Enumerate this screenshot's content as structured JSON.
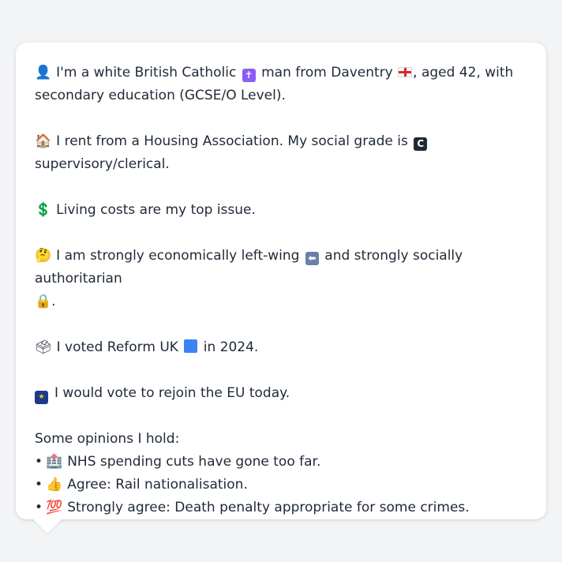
{
  "profile": {
    "intro": {
      "icon": "👤",
      "part1": "I'm a white British Catholic",
      "religion_icon": "✝",
      "part2": "man from Daventry",
      "part3": ", aged 42, with",
      "part4": "secondary education (GCSE/O Level)."
    },
    "housing": {
      "icon": "🏠",
      "part1": "I rent from a Housing Association. My social grade is",
      "grade_icon": "C",
      "part2": "supervisory/clerical."
    },
    "issue": {
      "icon": "💲",
      "text": "Living costs are my top issue."
    },
    "ideology": {
      "icon": "🤔",
      "part1": "I am strongly economically left-wing",
      "left_icon": "⬅",
      "part2": "and strongly socially authoritarian",
      "lock_icon": "🔒",
      "part3": "."
    },
    "vote": {
      "icon": "🗳",
      "part1": "I voted Reform UK",
      "part2": "in 2024."
    },
    "eu": {
      "icon": "★",
      "text": "I would vote to rejoin the EU today."
    },
    "opinions": {
      "heading": "Some opinions I hold:",
      "items": [
        {
          "bullet": "•",
          "icon": "🏥",
          "text": "NHS spending cuts have gone too far."
        },
        {
          "bullet": "•",
          "icon": "👍",
          "text": "Agree: Rail nationalisation."
        },
        {
          "bullet": "•",
          "icon": "💯",
          "text": "Strongly agree: Death penalty appropriate for some crimes."
        }
      ]
    }
  },
  "colors": {
    "background": "#f3f4f6",
    "card": "#ffffff",
    "text": "#1f2937",
    "reform_blue": "#3b82f6"
  }
}
